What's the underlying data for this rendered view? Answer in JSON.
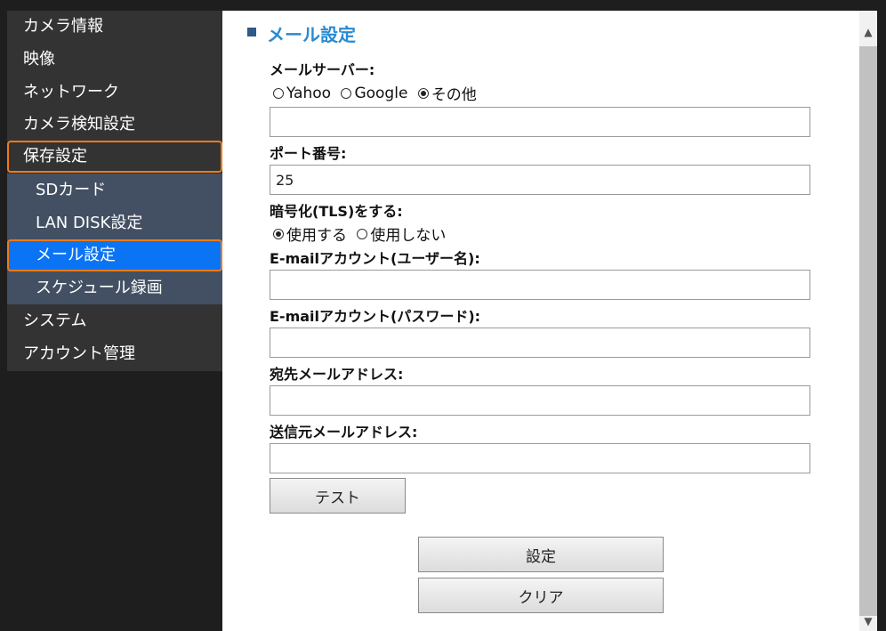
{
  "sidebar": {
    "items": [
      {
        "label": "カメラ情報"
      },
      {
        "label": "映像"
      },
      {
        "label": "ネットワーク"
      },
      {
        "label": "カメラ検知設定"
      },
      {
        "label": "保存設定"
      },
      {
        "label": "SDカード"
      },
      {
        "label": "LAN DISK設定"
      },
      {
        "label": "メール設定"
      },
      {
        "label": "スケジュール録画"
      },
      {
        "label": "システム"
      },
      {
        "label": "アカウント管理"
      }
    ]
  },
  "main": {
    "title": "メール設定",
    "mail_server": {
      "label": "メールサーバー:",
      "options": [
        "Yahoo",
        "Google",
        "その他"
      ],
      "selected": "その他",
      "value": ""
    },
    "port": {
      "label": "ポート番号:",
      "value": "25"
    },
    "tls": {
      "label": "暗号化(TLS)をする:",
      "options": [
        "使用する",
        "使用しない"
      ],
      "selected": "使用する"
    },
    "account_user": {
      "label": "E-mailアカウント(ユーザー名):",
      "value": ""
    },
    "account_password": {
      "label": "E-mailアカウント(パスワード):",
      "value": ""
    },
    "recipient": {
      "label": "宛先メールアドレス:",
      "value": ""
    },
    "sender": {
      "label": "送信元メールアドレス:",
      "value": ""
    },
    "test_button": "テスト",
    "save_button": "設定",
    "clear_button": "クリア"
  },
  "colors": {
    "sidebar_bg": "#333333",
    "submenu_bg": "#435063",
    "active_bg": "#0a74f5",
    "highlight_border": "#f07a1a",
    "title_color": "#2a8ad0"
  }
}
